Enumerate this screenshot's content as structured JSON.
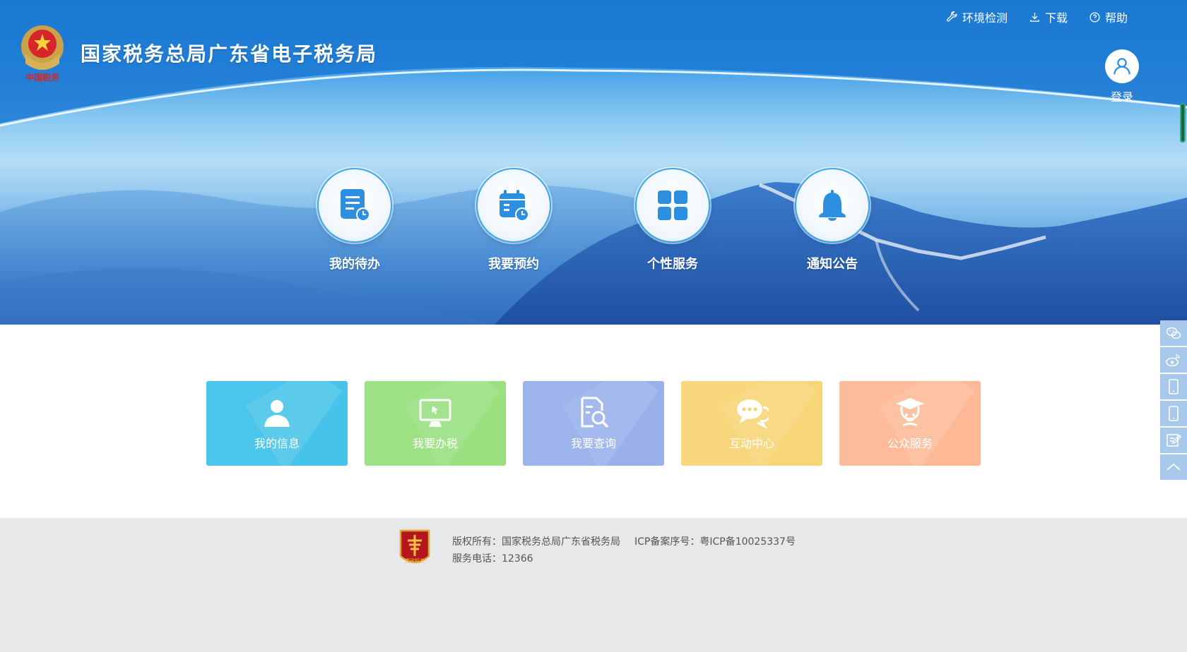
{
  "header": {
    "site_title": "国家税务总局广东省电子税务局",
    "logo_caption": "中国税务",
    "links": [
      {
        "label": "环境检测",
        "icon": "wrench-icon"
      },
      {
        "label": "下载",
        "icon": "download-icon"
      },
      {
        "label": "帮助",
        "icon": "help-icon"
      }
    ],
    "login_label": "登录"
  },
  "quick_entries": [
    {
      "label": "我的待办",
      "icon": "todo-list-icon"
    },
    {
      "label": "我要预约",
      "icon": "calendar-clock-icon"
    },
    {
      "label": "个性服务",
      "icon": "grid-icon"
    },
    {
      "label": "通知公告",
      "icon": "bell-icon"
    }
  ],
  "tiles": [
    {
      "label": "我的信息",
      "icon": "user-icon",
      "color": "#33bde8"
    },
    {
      "label": "我要办税",
      "icon": "monitor-icon",
      "color": "#8fdd72"
    },
    {
      "label": "我要查询",
      "icon": "document-search-icon",
      "color": "#8fa9ea"
    },
    {
      "label": "互动中心",
      "icon": "chat-icon",
      "color": "#f8d169"
    },
    {
      "label": "公众服务",
      "icon": "graduate-icon",
      "color": "#fdb28c"
    }
  ],
  "sidebar": [
    {
      "icon": "wechat-icon"
    },
    {
      "icon": "weibo-icon"
    },
    {
      "icon": "mobile-icon"
    },
    {
      "icon": "mobile-icon"
    },
    {
      "icon": "edit-icon"
    },
    {
      "icon": "back-to-top-icon"
    }
  ],
  "footer": {
    "copyright": "版权所有：国家税务总局广东省税务局",
    "icp": "ICP备案序号：粤ICP备10025337号",
    "phone": "服务电话：12366",
    "badge_text": "党政机关"
  },
  "colors": {
    "banner_top": "#1f7fd6",
    "ring_border": "#3fa8e8",
    "icon_blue": "#2d8fe0",
    "footer_bg": "#e6e8ea"
  }
}
